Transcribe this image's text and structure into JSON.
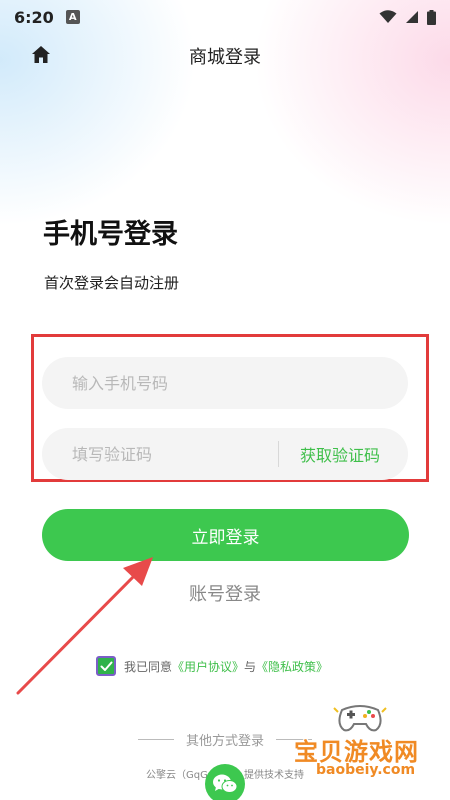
{
  "status_bar": {
    "time": "6:20",
    "notification_badge": "A",
    "icons": [
      "wifi-icon",
      "signal-icon",
      "battery-icon"
    ]
  },
  "header": {
    "title": "商城登录",
    "home_icon": "home-icon"
  },
  "login": {
    "heading": "手机号登录",
    "subheading": "首次登录会自动注册",
    "phone_placeholder": "输入手机号码",
    "phone_value": "",
    "code_placeholder": "填写验证码",
    "code_value": "",
    "get_code_label": "获取验证码",
    "submit_label": "立即登录",
    "account_login_label": "账号登录"
  },
  "agreement": {
    "checked": true,
    "prefix": "我已同意",
    "user_agreement": "《用户协议》",
    "conjunction": "与",
    "privacy_policy": "《隐私政策》"
  },
  "other_login": {
    "label": "其他方式登录",
    "wechat_icon": "wechat-icon"
  },
  "footer": {
    "text": "公擎云（GqGo……）提供技术支持"
  },
  "watermark": {
    "name_zh": "宝贝游戏网",
    "domain": "baobeiy.com"
  },
  "colors": {
    "accent": "#3dc84f",
    "link": "#3fbf4a",
    "highlight": "#e23b3b",
    "watermark": "#f08a24"
  }
}
